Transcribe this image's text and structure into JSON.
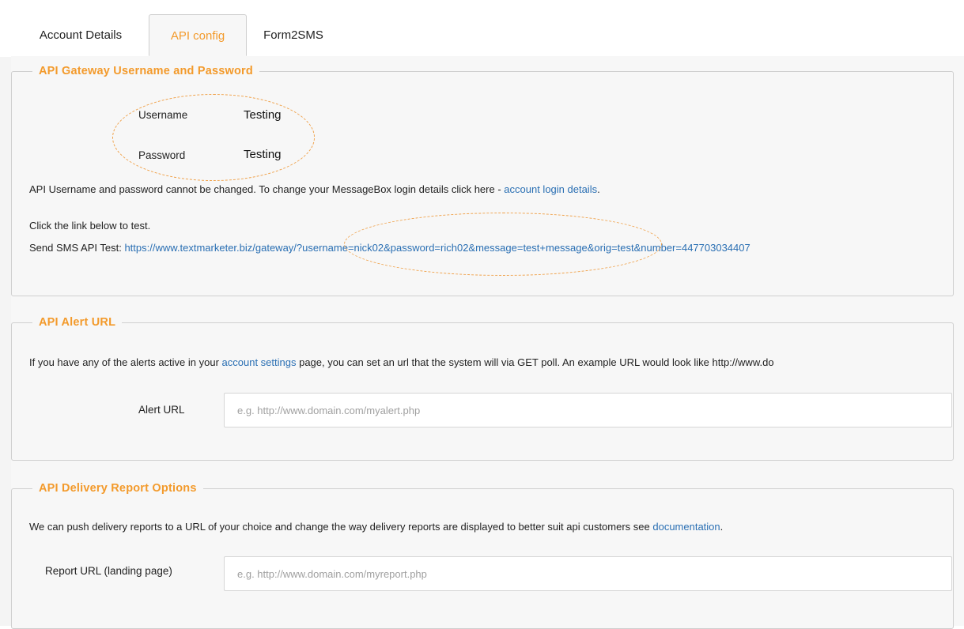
{
  "tabs": [
    {
      "label": "Account Details",
      "active": false
    },
    {
      "label": "API config",
      "active": true
    },
    {
      "label": "Form2SMS",
      "active": false
    }
  ],
  "gateway": {
    "legend": "API Gateway Username and Password",
    "username_label": "Username",
    "username_value": "Testing",
    "password_label": "Password",
    "password_value": "Testing",
    "notice_text": "API Username and password cannot be changed. To change your MessageBox login details click here - ",
    "notice_link": "account login details",
    "notice_end": ".",
    "test_intro": "Click the link below to test.",
    "test_label": "Send SMS API Test: ",
    "test_url": "https://www.textmarketer.biz/gateway/?username=nick02&password=rich02&message=test+message&orig=test&number=447703034407"
  },
  "alert": {
    "legend": "API Alert URL",
    "desc_start": "If you have any of the alerts active in your ",
    "desc_link": "account settings",
    "desc_end": " page, you can set an url that the system will via GET poll. An example URL would look like http://www.do",
    "field_label": "Alert URL",
    "placeholder": "e.g. http://www.domain.com/myalert.php",
    "value": ""
  },
  "delivery": {
    "legend": "API Delivery Report Options",
    "desc_start": "We can push delivery reports to a URL of your choice and change the way delivery reports are displayed to better suit api customers see ",
    "desc_link": "documentation",
    "desc_end": ".",
    "field_label": "Report URL (landing page)",
    "placeholder": "e.g. http://www.domain.com/myreport.php",
    "value": ""
  },
  "colors": {
    "accent": "#f39a2b",
    "link": "#2a6fb3",
    "border": "#cfcfcf",
    "panel_bg": "#f7f7f7"
  }
}
